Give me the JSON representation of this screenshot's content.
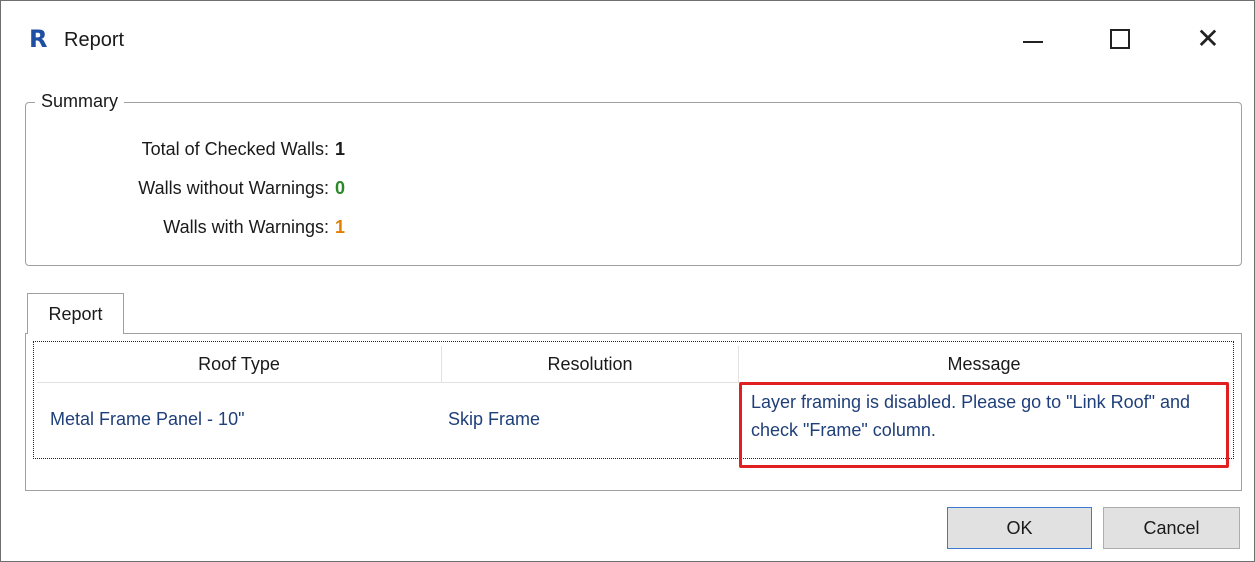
{
  "window": {
    "title": "Report",
    "app_logo": "R",
    "close_glyph": "✕"
  },
  "summary": {
    "group_label": "Summary",
    "rows": [
      {
        "label": "Total of Checked Walls:",
        "value": "1",
        "color": "#1a1a1a"
      },
      {
        "label": "Walls without Warnings:",
        "value": "0",
        "color": "#2a8a2a"
      },
      {
        "label": "Walls with Warnings:",
        "value": "1",
        "color": "#e07f00"
      }
    ]
  },
  "tabs": [
    {
      "label": "Report",
      "selected": true
    }
  ],
  "table": {
    "columns": [
      "Roof Type",
      "Resolution",
      "Message"
    ],
    "rows": [
      {
        "roof_type": "Metal Frame Panel - 10\"",
        "resolution": "Skip Frame",
        "message": "Layer framing is disabled. Please go to \"Link Roof\" and check \"Frame\" column."
      }
    ],
    "highlight_color": "#e02020"
  },
  "buttons": {
    "ok": "OK",
    "cancel": "Cancel"
  },
  "icons": {
    "minimize": "minimize-icon",
    "maximize": "maximize-icon",
    "close": "close-icon",
    "app": "revit-logo-icon"
  }
}
